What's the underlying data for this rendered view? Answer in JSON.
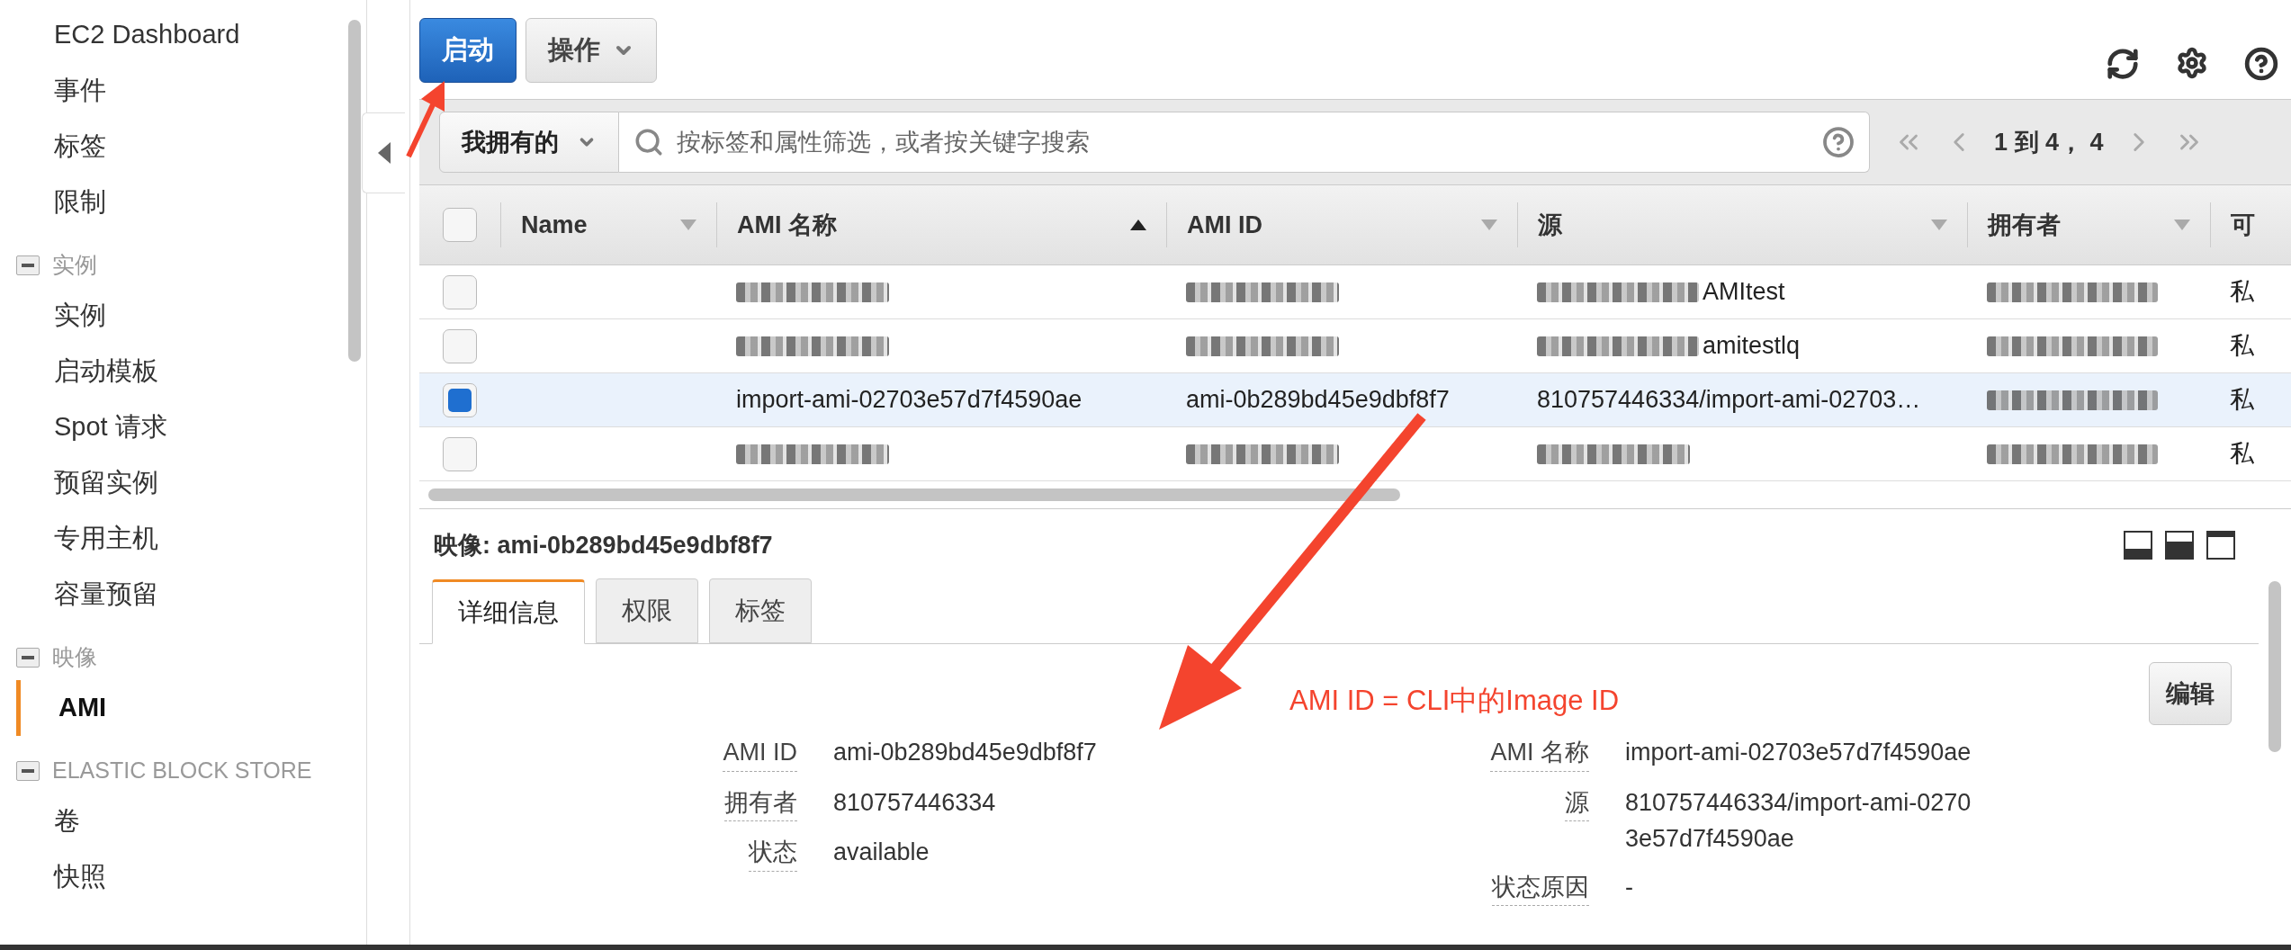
{
  "sidebar": {
    "top_items": [
      {
        "label": "EC2 Dashboard",
        "selected": false
      },
      {
        "label": "事件",
        "selected": false
      },
      {
        "label": "标签",
        "selected": false
      },
      {
        "label": "限制",
        "selected": false
      }
    ],
    "sections": [
      {
        "label": "实例",
        "expanded": true,
        "children": [
          {
            "label": "实例",
            "selected": false
          },
          {
            "label": "启动模板",
            "selected": false
          },
          {
            "label": "Spot 请求",
            "selected": false
          },
          {
            "label": "预留实例",
            "selected": false
          },
          {
            "label": "专用主机",
            "selected": false
          },
          {
            "label": "容量预留",
            "selected": false
          }
        ]
      },
      {
        "label": "映像",
        "expanded": true,
        "children": [
          {
            "label": "AMI",
            "selected": true
          }
        ]
      },
      {
        "label": "ELASTIC BLOCK STORE",
        "expanded": true,
        "children": [
          {
            "label": "卷",
            "selected": false
          },
          {
            "label": "快照",
            "selected": false
          }
        ]
      }
    ]
  },
  "toolbar": {
    "launch_button": "启动",
    "actions_button": "操作"
  },
  "filter": {
    "owner_dropdown": "我拥有的",
    "search": {
      "placeholder": "按标签和属性筛选，或者按关键字搜索"
    },
    "pagination": "1 到 4， 4"
  },
  "table": {
    "select_all_checked": false,
    "columns": [
      {
        "label": "Name",
        "sorted": false
      },
      {
        "label": "AMI 名称",
        "sorted": true
      },
      {
        "label": "AMI ID",
        "sorted": false
      },
      {
        "label": "源",
        "sorted": false
      },
      {
        "label": "拥有者",
        "sorted": false
      },
      {
        "label": "可"
      }
    ],
    "rows": [
      {
        "checked": false,
        "selected": false,
        "cells": [
          {
            "kind": "text",
            "text": ""
          },
          {
            "kind": "redacted"
          },
          {
            "kind": "redacted"
          },
          {
            "kind": "partial",
            "text": "AMItest"
          },
          {
            "kind": "redacted"
          },
          {
            "kind": "text",
            "text": "私"
          }
        ]
      },
      {
        "checked": false,
        "selected": false,
        "cells": [
          {
            "kind": "text",
            "text": ""
          },
          {
            "kind": "redacted"
          },
          {
            "kind": "redacted"
          },
          {
            "kind": "partial",
            "text": "amitestlq"
          },
          {
            "kind": "redacted"
          },
          {
            "kind": "text",
            "text": "私"
          }
        ]
      },
      {
        "checked": true,
        "selected": true,
        "cells": [
          {
            "kind": "text",
            "text": ""
          },
          {
            "kind": "text",
            "text": "import-ami-02703e57d7f4590ae"
          },
          {
            "kind": "text",
            "text": "ami-0b289bd45e9dbf8f7"
          },
          {
            "kind": "text",
            "text": "810757446334/import-ami-02703…"
          },
          {
            "kind": "redacted"
          },
          {
            "kind": "text",
            "text": "私"
          }
        ]
      },
      {
        "checked": false,
        "selected": false,
        "cells": [
          {
            "kind": "text",
            "text": ""
          },
          {
            "kind": "redacted"
          },
          {
            "kind": "redacted"
          },
          {
            "kind": "redacted"
          },
          {
            "kind": "redacted"
          },
          {
            "kind": "text",
            "text": "私"
          }
        ]
      }
    ]
  },
  "details": {
    "title_label": "映像:",
    "title_value": "ami-0b289bd45e9dbf8f7",
    "tabs": [
      {
        "label": "详细信息",
        "selected": true
      },
      {
        "label": "权限",
        "selected": false
      },
      {
        "label": "标签",
        "selected": false
      }
    ],
    "edit_button": "编辑",
    "left_fields": [
      {
        "label": "AMI ID",
        "value": "ami-0b289bd45e9dbf8f7"
      },
      {
        "label": "拥有者",
        "value": "810757446334"
      },
      {
        "label": "状态",
        "value": "available"
      }
    ],
    "right_fields": [
      {
        "label": "AMI 名称",
        "value": "import-ami-02703e57d7f4590ae"
      },
      {
        "label": "源",
        "value": "810757446334/import-ami-02703e57d7f4590ae"
      },
      {
        "label": "状态原因",
        "value": "-"
      }
    ]
  },
  "annotation": {
    "text": "AMI ID = CLI中的Image ID"
  }
}
